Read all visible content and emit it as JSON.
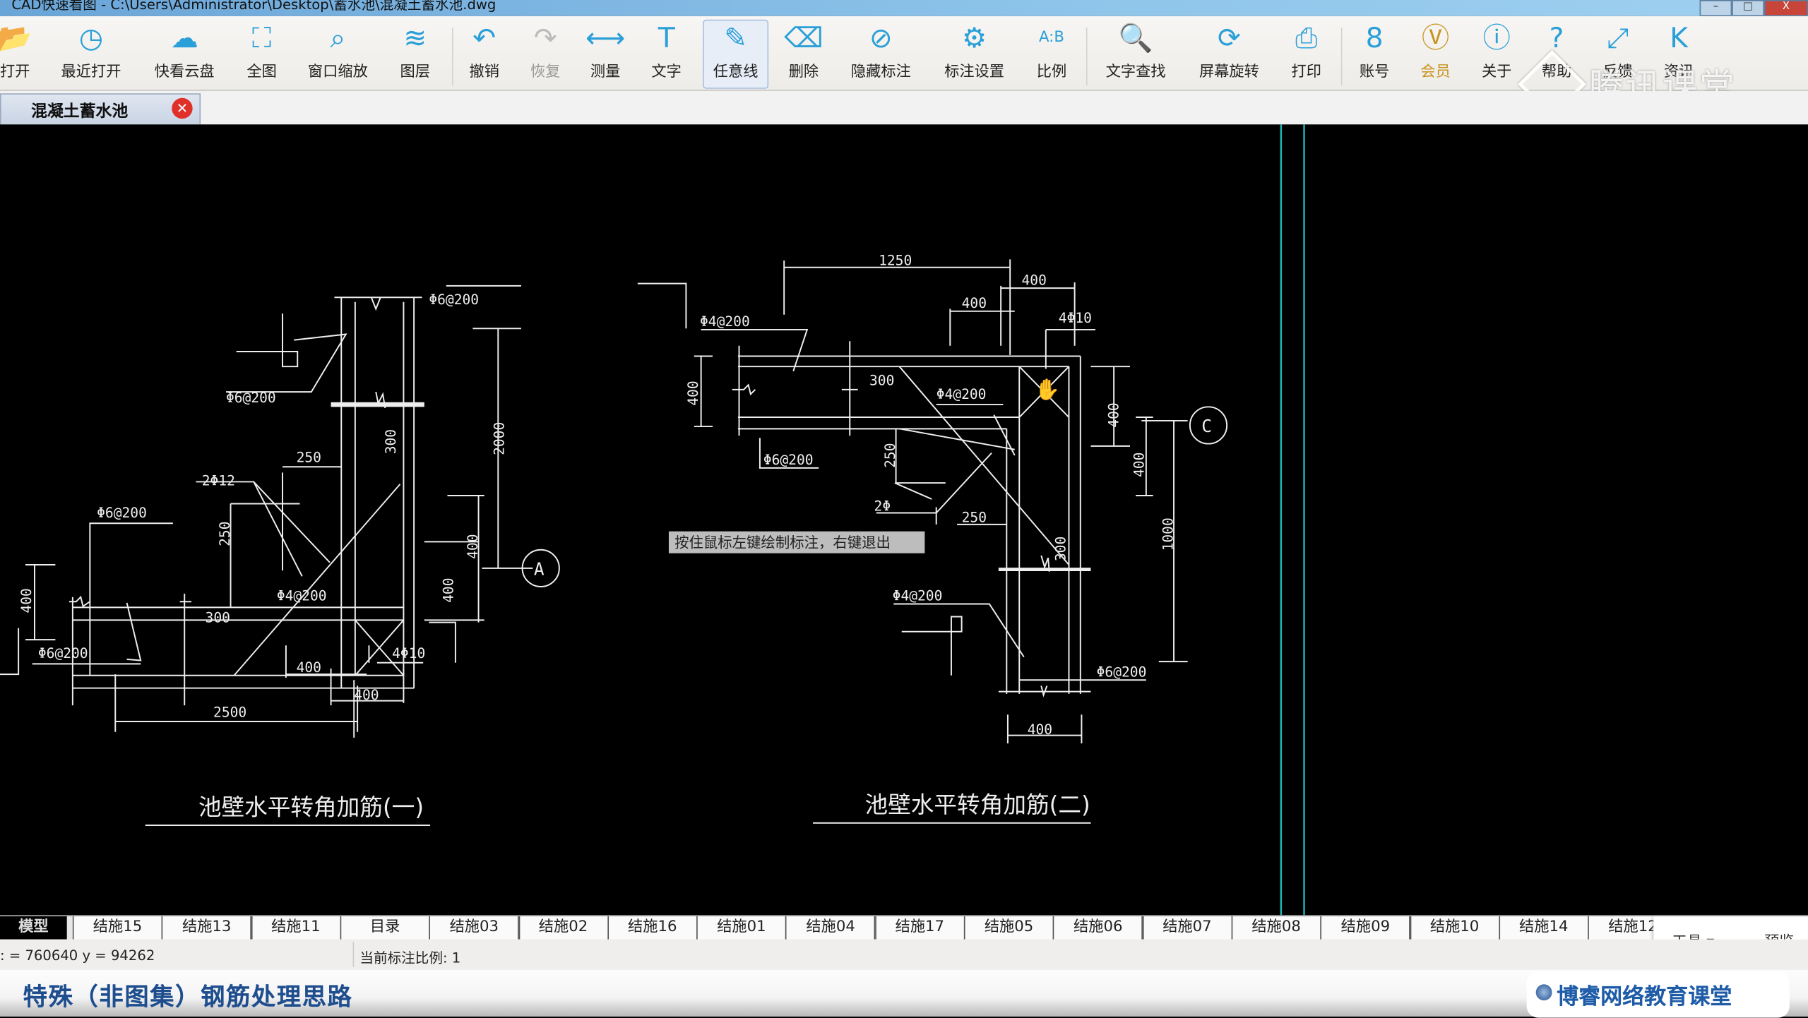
{
  "window": {
    "title": "CAD快速看图 - C:\\Users\\Administrator\\Desktop\\蓄水池\\混凝土蓄水池.dwg",
    "min": "–",
    "max": "□",
    "close": "X"
  },
  "toolbar": {
    "items": [
      {
        "label": "打开",
        "icon": "folder-open"
      },
      {
        "label": "最近打开",
        "icon": "clock-history"
      },
      {
        "label": "快看云盘",
        "icon": "cloud"
      },
      {
        "label": "全图",
        "icon": "fit-extent"
      },
      {
        "label": "窗口缩放",
        "icon": "zoom-window"
      },
      {
        "label": "图层",
        "icon": "layers"
      },
      {
        "label": "撤销",
        "icon": "undo"
      },
      {
        "label": "恢复",
        "icon": "redo",
        "state": "disabled"
      },
      {
        "label": "测量",
        "icon": "ruler"
      },
      {
        "label": "文字",
        "icon": "text-T"
      },
      {
        "label": "任意线",
        "icon": "pen",
        "state": "selected"
      },
      {
        "label": "删除",
        "icon": "eraser"
      },
      {
        "label": "隐藏标注",
        "icon": "eye-hidden"
      },
      {
        "label": "标注设置",
        "icon": "dimension-settings"
      },
      {
        "label": "比例",
        "icon": "scale-ab"
      },
      {
        "label": "文字查找",
        "icon": "text-search"
      },
      {
        "label": "屏幕旋转",
        "icon": "rotate-screen"
      },
      {
        "label": "打印",
        "icon": "printer"
      },
      {
        "label": "账号",
        "icon": "user"
      },
      {
        "label": "会员",
        "icon": "vip-badge"
      },
      {
        "label": "关于",
        "icon": "info"
      },
      {
        "label": "帮助",
        "icon": "help"
      },
      {
        "label": "反馈",
        "icon": "external-link"
      },
      {
        "label": "资讯",
        "icon": "k-logo"
      }
    ],
    "accent": "#2a9fd8",
    "vip_color": "#c89420"
  },
  "watermark": "腾讯课堂",
  "doc_tab": {
    "label": "混凝土蓄水池",
    "close_icon": "close-circle"
  },
  "drawing1": {
    "title": "池壁水平转角加筋(一)",
    "labels": [
      "Φ6@200",
      "Φ6@200",
      "250",
      "2Φ12",
      "Φ6@200",
      "250",
      "300",
      "2000",
      "400",
      "400",
      "Φ4@200",
      "300",
      "400",
      "Φ6@200",
      "4Φ10",
      "400",
      "400",
      "2500"
    ],
    "axis_bubble": "A"
  },
  "drawing2": {
    "title": "池壁水平转角加筋(二)",
    "labels": [
      "1250",
      "400",
      "400",
      "4Φ10",
      "Φ4@200",
      "400",
      "300",
      "Φ4@200",
      "Φ6@200",
      "250",
      "2Φ",
      "250",
      "400",
      "400",
      "1000",
      "300",
      "Φ4@200",
      "Φ6@200",
      "400"
    ],
    "axis_bubble": "C"
  },
  "tooltip": "按住鼠标左键绘制标注，右键退出",
  "layout_tabs": [
    "模型",
    "结施15",
    "结施13",
    "结施11",
    "目录",
    "结施03",
    "结施02",
    "结施16",
    "结施01",
    "结施04",
    "结施17",
    "结施05",
    "结施06",
    "结施07",
    "结施08",
    "结施09",
    "结施10",
    "结施14",
    "结施12"
  ],
  "float_panel": {
    "tools": "工具 ▾",
    "preview": "预览"
  },
  "status": {
    "coords": ": = 760640 y = 94262",
    "scale": "当前标注比例: 1"
  },
  "banner": {
    "heading": "特殊（非图集）钢筋处理思路",
    "logo_text": "博睿网络教育课堂"
  },
  "colors": {
    "canvas": "#000000",
    "guide_line": "#1fb5b5",
    "drawing": "#eeeeee"
  }
}
